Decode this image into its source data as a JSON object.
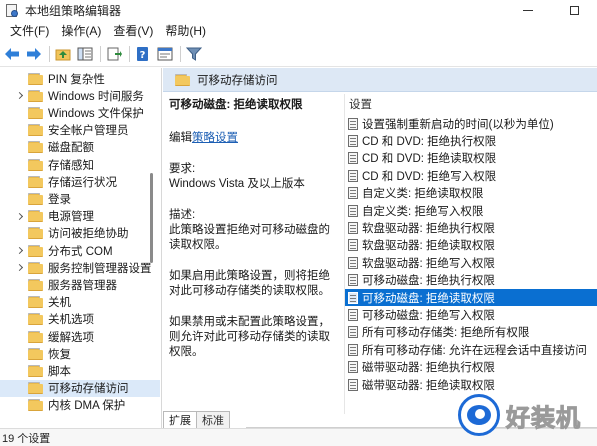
{
  "window": {
    "title": "本地组策略编辑器"
  },
  "menu": {
    "items": [
      {
        "label": "文件(F)"
      },
      {
        "label": "操作(A)"
      },
      {
        "label": "查看(V)"
      },
      {
        "label": "帮助(H)"
      }
    ]
  },
  "toolbar": {
    "icons": [
      "back-arrow-icon",
      "forward-arrow-icon",
      "up-folder-icon",
      "show-hide-tree-icon",
      "export-icon",
      "help-icon",
      "properties-icon",
      "filter-icon"
    ]
  },
  "tree": {
    "items": [
      {
        "label": "PIN 复杂性",
        "expandable": false
      },
      {
        "label": "Windows 时间服务",
        "expandable": true
      },
      {
        "label": "Windows 文件保护",
        "expandable": false
      },
      {
        "label": "安全帐户管理员",
        "expandable": false
      },
      {
        "label": "磁盘配额",
        "expandable": false
      },
      {
        "label": "存储感知",
        "expandable": false
      },
      {
        "label": "存储运行状况",
        "expandable": false
      },
      {
        "label": "登录",
        "expandable": false
      },
      {
        "label": "电源管理",
        "expandable": true
      },
      {
        "label": "访问被拒绝协助",
        "expandable": false
      },
      {
        "label": "分布式 COM",
        "expandable": true
      },
      {
        "label": "服务控制管理器设置",
        "expandable": true
      },
      {
        "label": "服务器管理器",
        "expandable": false
      },
      {
        "label": "关机",
        "expandable": false
      },
      {
        "label": "关机选项",
        "expandable": false
      },
      {
        "label": "缓解选项",
        "expandable": false
      },
      {
        "label": "恢复",
        "expandable": false
      },
      {
        "label": "脚本",
        "expandable": false
      },
      {
        "label": "可移动存储访问",
        "expandable": false,
        "selected": true
      },
      {
        "label": "内核 DMA 保护",
        "expandable": false
      }
    ]
  },
  "detail": {
    "header": "可移动存储访问",
    "policy_title": "可移动磁盘: 拒绝读取权限",
    "edit_prefix": "编辑",
    "edit_link": "策略设置",
    "requirements_label": "要求:",
    "requirements_value": "Windows Vista 及以上版本",
    "description_label": "描述:",
    "description_text": "此策略设置拒绝对可移动磁盘的读取权限。",
    "enabled_text": "如果启用此策略设置，则将拒绝对此可移动存储类的读取权限。",
    "disabled_text": "如果禁用或未配置此策略设置，则允许对此可移动存储类的读取权限。"
  },
  "settings": {
    "header": "设置",
    "items": [
      {
        "label": "设置强制重新启动的时间(以秒为单位)"
      },
      {
        "label": "CD 和 DVD: 拒绝执行权限"
      },
      {
        "label": "CD 和 DVD: 拒绝读取权限"
      },
      {
        "label": "CD 和 DVD: 拒绝写入权限"
      },
      {
        "label": "自定义类: 拒绝读取权限"
      },
      {
        "label": "自定义类: 拒绝写入权限"
      },
      {
        "label": "软盘驱动器: 拒绝执行权限"
      },
      {
        "label": "软盘驱动器: 拒绝读取权限"
      },
      {
        "label": "软盘驱动器: 拒绝写入权限"
      },
      {
        "label": "可移动磁盘: 拒绝执行权限"
      },
      {
        "label": "可移动磁盘: 拒绝读取权限",
        "selected": true
      },
      {
        "label": "可移动磁盘: 拒绝写入权限"
      },
      {
        "label": "所有可移动存储类: 拒绝所有权限"
      },
      {
        "label": "所有可移动存储: 允许在远程会话中直接访问"
      },
      {
        "label": "磁带驱动器: 拒绝执行权限"
      },
      {
        "label": "磁带驱动器: 拒绝读取权限"
      }
    ]
  },
  "tabs": {
    "extended": "扩展",
    "standard": "标准"
  },
  "status": {
    "text": "19 个设置"
  },
  "watermark": {
    "text": "好装机"
  }
}
